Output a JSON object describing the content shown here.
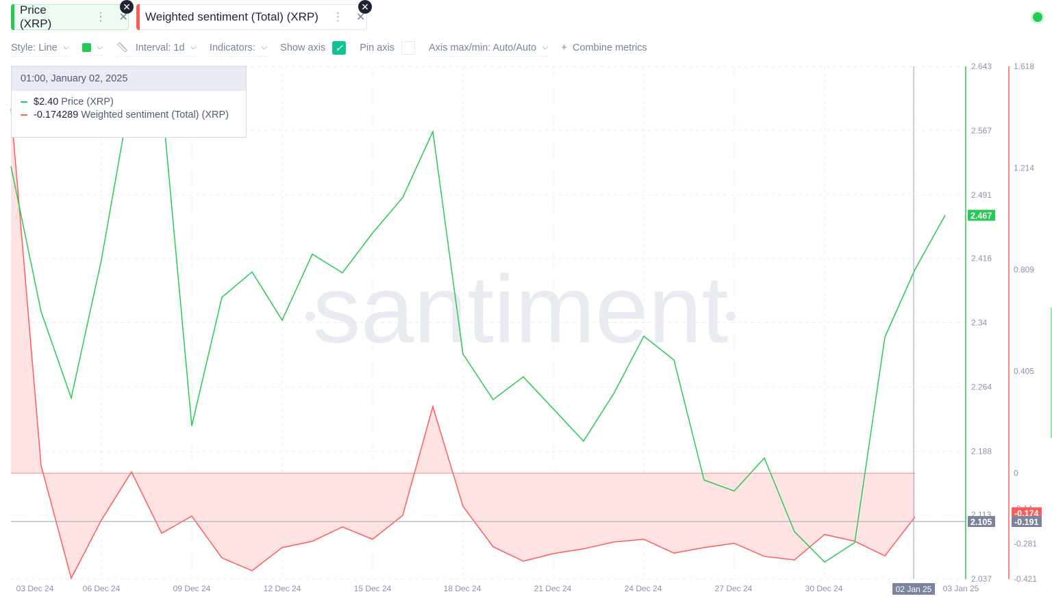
{
  "tabs": [
    {
      "label": "Price (XRP)",
      "color": "#26c953"
    },
    {
      "label": "Weighted sentiment (Total) (XRP)",
      "color": "#ff5b5b"
    }
  ],
  "toolbar": {
    "style": "Style: Line",
    "interval": "Interval: 1d",
    "indicators": "Indicators:",
    "show_axis": "Show axis",
    "pin_axis": "Pin axis",
    "axis_maxmin": "Axis max/min: Auto/Auto",
    "combine": "Combine metrics"
  },
  "tooltip": {
    "date": "01:00, January 02, 2025",
    "price_value": "$2.40",
    "price_name": "Price (XRP)",
    "sent_value": "-0.174289",
    "sent_name": "Weighted sentiment (Total) (XRP)"
  },
  "watermark": "santiment",
  "chart_data": {
    "type": "line",
    "x": [
      "03 Dec",
      "04 Dec",
      "05 Dec",
      "06 Dec",
      "07 Dec",
      "08 Dec",
      "09 Dec",
      "10 Dec",
      "11 Dec",
      "12 Dec",
      "13 Dec",
      "14 Dec",
      "15 Dec",
      "16 Dec",
      "17 Dec",
      "18 Dec",
      "19 Dec",
      "20 Dec",
      "21 Dec",
      "22 Dec",
      "23 Dec",
      "24 Dec",
      "25 Dec",
      "26 Dec",
      "27 Dec",
      "28 Dec",
      "29 Dec",
      "30 Dec",
      "31 Dec",
      "01 Jan",
      "02 Jan",
      "03 Jan"
    ],
    "xticks": [
      "03 Dec 24",
      "06 Dec 24",
      "09 Dec 24",
      "12 Dec 24",
      "15 Dec 24",
      "18 Dec 24",
      "21 Dec 24",
      "24 Dec 24",
      "27 Dec 24",
      "30 Dec 24",
      "02 Jan 25",
      "03 Jan 25"
    ],
    "series": [
      {
        "name": "Price (XRP)",
        "axis": "left",
        "color": "#26c953",
        "values": [
          2.525,
          2.353,
          2.251,
          2.414,
          2.616,
          2.608,
          2.218,
          2.37,
          2.4,
          2.343,
          2.421,
          2.399,
          2.446,
          2.488,
          2.566,
          2.303,
          2.249,
          2.276,
          2.238,
          2.2,
          2.256,
          2.324,
          2.296,
          2.154,
          2.141,
          2.18,
          2.093,
          2.057,
          2.08,
          2.323,
          2.403,
          2.467
        ]
      },
      {
        "name": "Weighted sentiment (Total) (XRP)",
        "axis": "right",
        "color": "#ff5b5b",
        "values": [
          1.45,
          0.03,
          -0.418,
          -0.187,
          0.005,
          -0.239,
          -0.171,
          -0.337,
          -0.388,
          -0.296,
          -0.271,
          -0.214,
          -0.263,
          -0.168,
          0.265,
          -0.132,
          -0.293,
          -0.35,
          -0.32,
          -0.301,
          -0.274,
          -0.263,
          -0.318,
          -0.296,
          -0.279,
          -0.331,
          -0.345,
          -0.244,
          -0.271,
          -0.329,
          -0.174
        ]
      }
    ],
    "price_axis": {
      "ylim": [
        2.037,
        2.643
      ],
      "ticks": [
        "2.643",
        "2.567",
        "2.491",
        "2.416",
        "2.34",
        "2.264",
        "2.188",
        "2.113",
        "2.037"
      ],
      "current": "2.467",
      "crosshair": "2.105"
    },
    "sentiment_axis": {
      "ylim": [
        -0.421,
        1.618
      ],
      "ticks": [
        "1.618",
        "1.214",
        "0.809",
        "0.405",
        "0",
        "-0.14",
        "-0.281",
        "-0.421"
      ],
      "current": "-0.174",
      "crosshair": "-0.191"
    },
    "crosshair_date": "02 Jan 25"
  }
}
